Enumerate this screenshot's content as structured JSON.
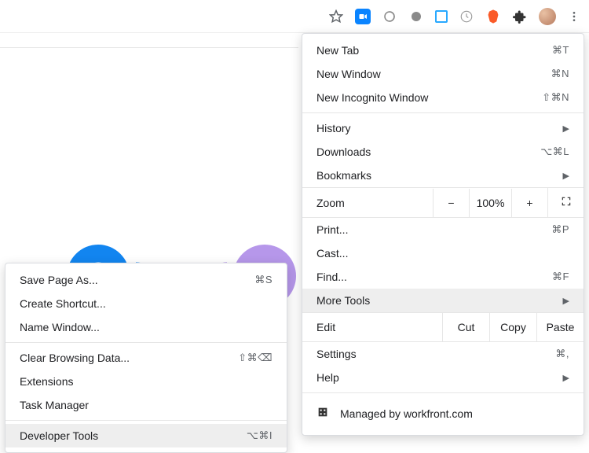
{
  "toolbar": {
    "star_icon": "star",
    "zoom_icon": "zoom",
    "menu_icon": "vertical-dots"
  },
  "menu": {
    "new_tab": {
      "label": "New Tab",
      "shortcut": "⌘T"
    },
    "new_window": {
      "label": "New Window",
      "shortcut": "⌘N"
    },
    "new_incognito": {
      "label": "New Incognito Window",
      "shortcut": "⇧⌘N"
    },
    "history": {
      "label": "History"
    },
    "downloads": {
      "label": "Downloads",
      "shortcut": "⌥⌘L"
    },
    "bookmarks": {
      "label": "Bookmarks"
    },
    "zoom": {
      "label": "Zoom",
      "minus": "−",
      "value": "100%",
      "plus": "+",
      "fs_icon": "fullscreen"
    },
    "print": {
      "label": "Print...",
      "shortcut": "⌘P"
    },
    "cast": {
      "label": "Cast..."
    },
    "find": {
      "label": "Find...",
      "shortcut": "⌘F"
    },
    "more_tools": {
      "label": "More Tools"
    },
    "edit": {
      "label": "Edit",
      "cut": "Cut",
      "copy": "Copy",
      "paste": "Paste"
    },
    "settings": {
      "label": "Settings",
      "shortcut": "⌘,"
    },
    "help": {
      "label": "Help"
    },
    "managed": {
      "label": "Managed by workfront.com"
    }
  },
  "submenu": {
    "save_page": {
      "label": "Save Page As...",
      "shortcut": "⌘S"
    },
    "create_shortcut": {
      "label": "Create Shortcut..."
    },
    "name_window": {
      "label": "Name Window..."
    },
    "clear_browsing": {
      "label": "Clear Browsing Data...",
      "shortcut": "⇧⌘⌫"
    },
    "extensions": {
      "label": "Extensions"
    },
    "task_manager": {
      "label": "Task Manager"
    },
    "developer_tools": {
      "label": "Developer Tools",
      "shortcut": "⌥⌘I"
    }
  }
}
